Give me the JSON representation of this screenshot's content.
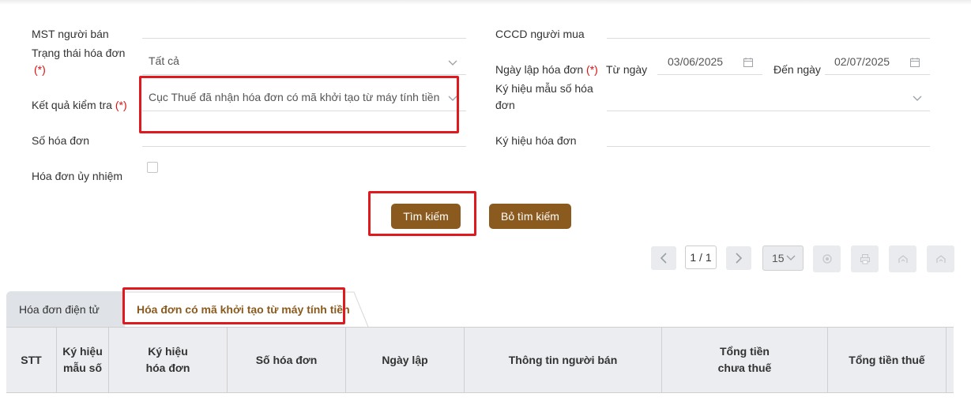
{
  "form": {
    "seller_tax_label": "MST người bán",
    "status_label": "Trạng thái hóa đơn",
    "status_req": "(*)",
    "status_value": "Tất cả",
    "check_result_label": "Kết quả kiểm tra",
    "check_result_req": "(*)",
    "check_result_value": "Cục Thuế đã nhận hóa đơn có mã khởi tạo từ máy tính tiền",
    "invoice_number_label": "Số hóa đơn",
    "authorized_label": "Hóa đơn ủy nhiệm",
    "buyer_id_label": "CCCD người mua",
    "issue_date_label": "Ngày lập hóa đơn",
    "issue_date_req": "(*)",
    "from_label": "Từ ngày",
    "from_value": "03/06/2025",
    "to_label": "Đến ngày",
    "to_value": "02/07/2025",
    "template_label_1": "Ký hiệu mẫu số hóa",
    "template_label_2": "đơn",
    "symbol_label": "Ký hiệu hóa đơn"
  },
  "actions": {
    "search_label": "Tìm kiếm",
    "clear_label": "Bỏ tìm kiếm"
  },
  "pagination": {
    "page": "1 / 1",
    "page_size": "15"
  },
  "tabs": [
    {
      "label": "Hóa đơn điện tử"
    },
    {
      "label": "Hóa đơn có mã khởi tạo từ máy tính tiền"
    }
  ],
  "table": {
    "columns": [
      {
        "line1": "STT",
        "line2": ""
      },
      {
        "line1": "Ký hiệu",
        "line2": "mẫu số"
      },
      {
        "line1": "Ký hiệu",
        "line2": "hóa đơn"
      },
      {
        "line1": "Số hóa đơn",
        "line2": ""
      },
      {
        "line1": "Ngày lập",
        "line2": ""
      },
      {
        "line1": "Thông tin người bán",
        "line2": ""
      },
      {
        "line1": "Tổng tiền",
        "line2": "chưa thuế"
      },
      {
        "line1": "Tổng tiền thuế",
        "line2": ""
      }
    ]
  },
  "colors": {
    "accent": "#8b5a1e",
    "highlight": "#e0191f",
    "required": "#dd1111"
  }
}
